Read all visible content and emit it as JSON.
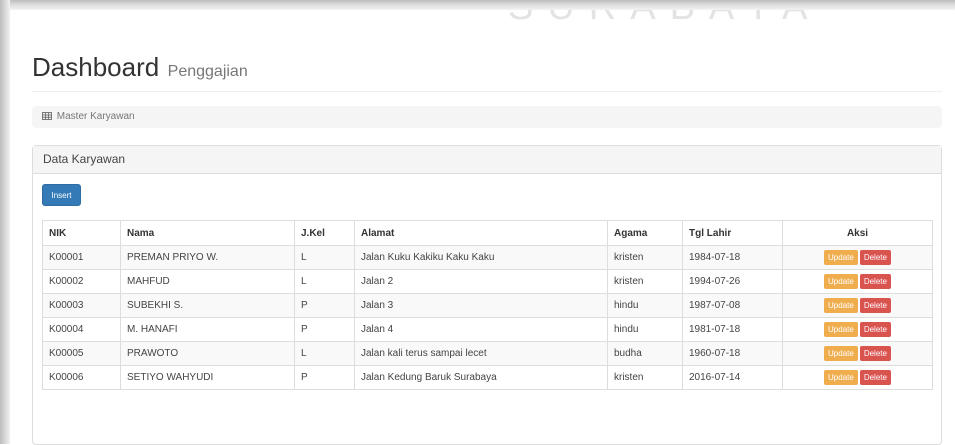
{
  "watermark": "SURABAYA",
  "header": {
    "title": "Dashboard",
    "subtitle": "Penggajian"
  },
  "breadcrumb": {
    "icon": "table-icon",
    "label": "Master Karyawan"
  },
  "panel": {
    "title": "Data Karyawan",
    "insert_label": "Insert",
    "columns": [
      "NIK",
      "Nama",
      "J.Kel",
      "Alamat",
      "Agama",
      "Tgl Lahir",
      "Aksi"
    ],
    "rows": [
      [
        "K00001",
        "PREMAN PRIYO W.",
        "L",
        "Jalan Kuku Kakiku Kaku Kaku",
        "kristen",
        "1984-07-18"
      ],
      [
        "K00002",
        "MAHFUD",
        "L",
        "Jalan 2",
        "kristen",
        "1994-07-26"
      ],
      [
        "K00003",
        "SUBEKHI S.",
        "P",
        "Jalan 3",
        "hindu",
        "1987-07-08"
      ],
      [
        "K00004",
        "M. HANAFI",
        "P",
        "Jalan 4",
        "hindu",
        "1981-07-18"
      ],
      [
        "K00005",
        "PRAWOTO",
        "L",
        "Jalan kali terus sampai lecet",
        "budha",
        "1960-07-18"
      ],
      [
        "K00006",
        "SETIYO WAHYUDI",
        "P",
        "Jalan Kedung Baruk Surabaya",
        "kristen",
        "2016-07-14"
      ]
    ],
    "update_label": "Update",
    "delete_label": "Delete"
  },
  "colors": {
    "primary": "#337ab7",
    "warning": "#f0ad4e",
    "danger": "#d9534f"
  }
}
